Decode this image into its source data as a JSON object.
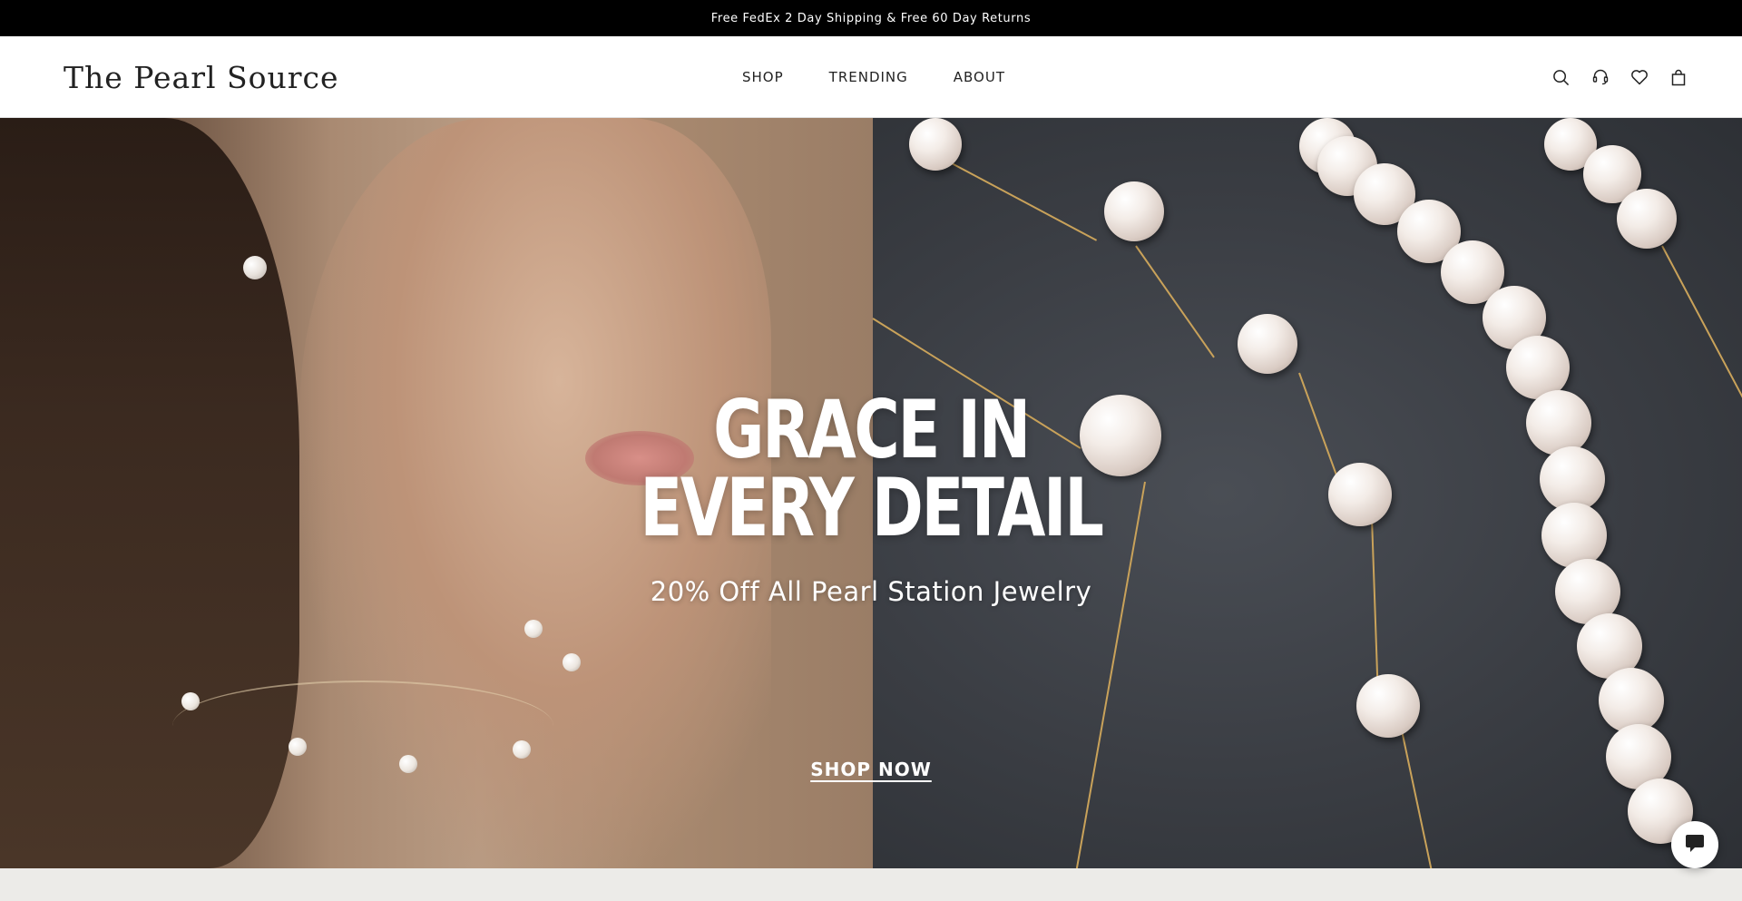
{
  "announcement": {
    "text": "Free FedEx 2 Day Shipping & Free 60 Day Returns"
  },
  "header": {
    "logo": "The Pearl Source",
    "nav": [
      {
        "label": "SHOP"
      },
      {
        "label": "TRENDING"
      },
      {
        "label": "ABOUT"
      }
    ],
    "icons": [
      "search-icon",
      "support-headset-icon",
      "wishlist-heart-icon",
      "shopping-bag-icon"
    ]
  },
  "hero": {
    "headline_line1": "GRACE IN",
    "headline_line2": "EVERY DETAIL",
    "subheadline": "20% Off All Pearl Station Jewelry",
    "cta_label": "SHOP NOW"
  },
  "chat": {
    "icon": "chat-bubble-icon"
  },
  "colors": {
    "announcement_bg": "#000000",
    "header_bg": "#ffffff",
    "text": "#222222",
    "hero_text": "#ffffff"
  }
}
